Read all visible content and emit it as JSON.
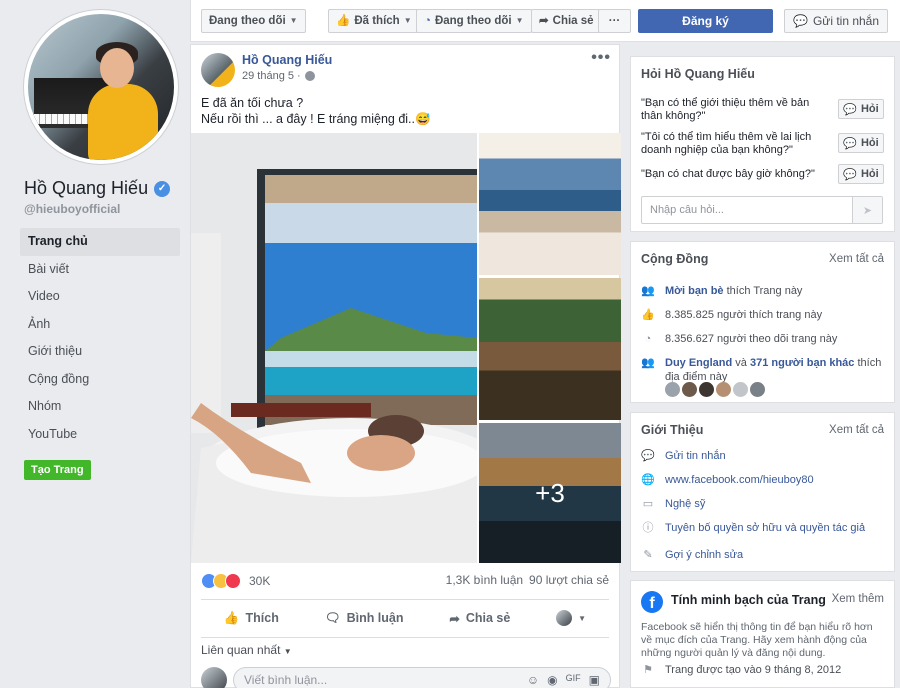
{
  "sidebar": {
    "page_name": "Hồ Quang Hiếu",
    "handle": "@hieuboyofficial",
    "nav": [
      "Trang chủ",
      "Bài viết",
      "Video",
      "Ảnh",
      "Giới thiệu",
      "Cộng đồng",
      "Nhóm",
      "YouTube"
    ],
    "create_page": "Tạo Trang"
  },
  "topbar": {
    "following": "Đang theo dõi",
    "liked": "Đã thích",
    "following2": "Đang theo dõi",
    "share": "Chia sẻ",
    "more": "···",
    "signup": "Đăng ký",
    "message": "Gửi tin nhắn"
  },
  "post": {
    "author": "Hồ Quang Hiếu",
    "time": "29 tháng 5 ·",
    "text_line1": "E đã ăn tối chưa ?",
    "text_line2": "Nếu rồi thì ... a đây ! E tráng miệng đi..😅",
    "more_photos": "+3",
    "reaction_count": "30K",
    "comments": "1,3K bình luận",
    "shares": "90 lượt chia sẻ",
    "like": "Thích",
    "comment": "Bình luận",
    "share": "Chia sẻ",
    "most_relevant": "Liên quan nhất",
    "comment_placeholder": "Viết bình luận..."
  },
  "ask": {
    "title": "Hỏi Hồ Quang Hiếu",
    "questions": [
      "\"Bạn có thể giới thiệu thêm về bản thân không?\"",
      "\"Tôi có thể tìm hiểu thêm về lai lịch doanh nghiệp của bạn không?\"",
      "\"Bạn có chat được bây giờ không?\""
    ],
    "ask_label": "Hỏi",
    "input_placeholder": "Nhập câu hỏi..."
  },
  "community": {
    "title": "Cộng Đồng",
    "see_all": "Xem tất cả",
    "invite": "Mời bạn bè",
    "invite_suffix": "thích Trang này",
    "likes": "8.385.825 người thích trang này",
    "follows": "8.356.627 người theo dõi trang này",
    "friend_name": "Duy England",
    "friend_mid": "và",
    "friend_others": "371 người bạn khác",
    "friend_suffix": "thích địa điểm này"
  },
  "about": {
    "title": "Giới Thiệu",
    "see_all": "Xem tất cả",
    "message": "Gửi tin nhắn",
    "website": "www.facebook.com/hieuboy80",
    "category": "Nghệ sỹ",
    "copyright": "Tuyên bố quyền sở hữu và quyền tác giả",
    "suggest": "Gợi ý chỉnh sửa"
  },
  "transparency": {
    "title": "Tính minh bạch của Trang",
    "see_more": "Xem thêm",
    "text": "Facebook sẽ hiển thị thông tin để bạn hiểu rõ hơn về mục đích của Trang. Hãy xem hành động của những người quản lý và đăng nội dung.",
    "created": "Trang được tạo vào 9 tháng 8, 2012"
  },
  "colors": {
    "brand_blue": "#4267b2",
    "link_blue": "#385898",
    "green": "#42b72a",
    "bg": "#e9ebee"
  }
}
